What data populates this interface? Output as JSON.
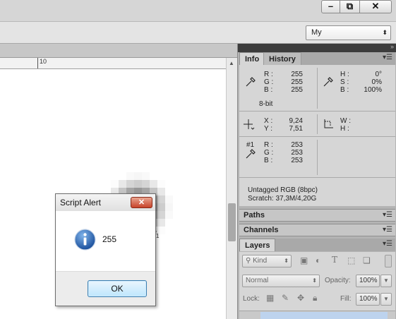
{
  "window": {
    "min_glyph": "–",
    "restore_glyph": "⧉",
    "close_glyph": "✕"
  },
  "options_bar": {
    "workspace_value": "My"
  },
  "ruler": {
    "tick_label": "10"
  },
  "canvas": {
    "cursor_index": "1"
  },
  "dialog": {
    "title": "Script Alert",
    "message": "255",
    "ok_label": "OK",
    "close_glyph": "✕"
  },
  "panels": {
    "info_tab": "Info",
    "history_tab": "History",
    "paths_title": "Paths",
    "channels_title": "Channels",
    "layers_title": "Layers"
  },
  "info": {
    "rgb": {
      "r_label": "R :",
      "g_label": "G :",
      "b_label": "B :",
      "r": "255",
      "g": "255",
      "b": "255"
    },
    "hsb": {
      "h_label": "H :",
      "s_label": "S :",
      "b_label": "B :",
      "h": "0°",
      "s": "0%",
      "b": "100%"
    },
    "bit_depth": "8-bit",
    "xy": {
      "x_label": "X :",
      "y_label": "Y :",
      "x": "9,24",
      "y": "7,51"
    },
    "wh": {
      "w_label": "W :",
      "h_label": "H :"
    },
    "sampler": {
      "id": "#1",
      "r_label": "R :",
      "g_label": "G :",
      "b_label": "B :",
      "r": "253",
      "g": "253",
      "b": "253"
    },
    "doc_profile": "Untagged RGB (8bpc)",
    "scratch": "Scratch: 37,3M/4,20G"
  },
  "layers": {
    "kind_label": "Kind",
    "blend_mode": "Normal",
    "opacity_label": "Opacity:",
    "opacity_value": "100%",
    "lock_label": "Lock:",
    "fill_label": "Fill:",
    "fill_value": "100%"
  }
}
